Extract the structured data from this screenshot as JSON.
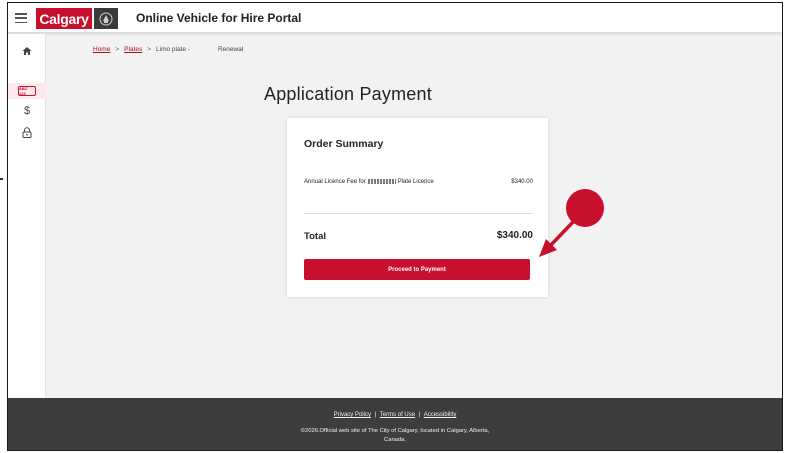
{
  "header": {
    "logo_text": "Calgary",
    "app_title": "Online Vehicle for Hire Portal"
  },
  "sidebar": {
    "items": [
      {
        "name": "home",
        "icon": "home-icon"
      },
      {
        "name": "plate",
        "icon": "plate-icon",
        "icon_text": "ABC 123"
      },
      {
        "name": "payments",
        "icon": "dollar-icon",
        "glyph": "$"
      },
      {
        "name": "security",
        "icon": "lock-icon"
      }
    ]
  },
  "breadcrumb": {
    "home": "Home",
    "plates": "Plates",
    "current": "Limo plate -",
    "action": "Renewal",
    "separator": ">"
  },
  "page": {
    "title": "Application Payment"
  },
  "order": {
    "title": "Order Summary",
    "line_prefix": "Annual Licence Fee for",
    "line_suffix": "Plate Licence",
    "line_amount": "$340.00",
    "total_label": "Total",
    "total_amount": "$340.00",
    "button_label": "Proceed to Payment"
  },
  "footer": {
    "links": [
      "Privacy Policy",
      "Terms of Use",
      "Accessibility"
    ],
    "separator": "|",
    "copyright_line1": "©2026.Official web site of The City of Calgary, located in Calgary, Alberta,",
    "copyright_line2": "Canada."
  },
  "colors": {
    "brand_red": "#c8102e",
    "footer_bg": "#3d3d3d",
    "annotation_red": "#c8102e"
  }
}
